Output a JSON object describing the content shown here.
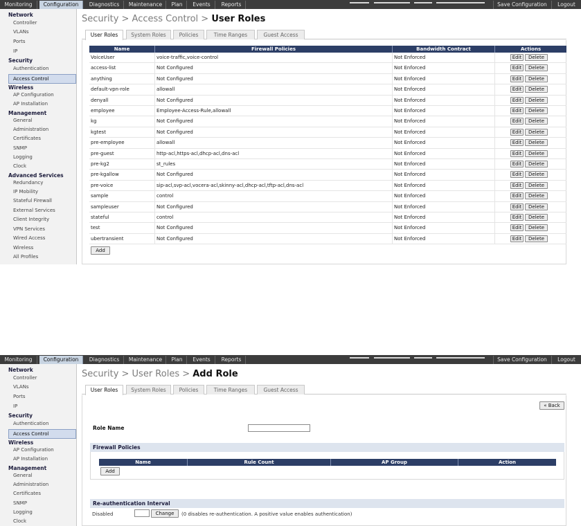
{
  "nav": {
    "tabs": [
      "Monitoring",
      "Configuration",
      "Diagnostics",
      "Maintenance",
      "Plan",
      "Events",
      "Reports"
    ],
    "active": "Configuration",
    "save_configuration": "Save Configuration",
    "logout": "Logout"
  },
  "sidebar": {
    "items": [
      {
        "label": "Network",
        "kind": "head"
      },
      {
        "label": "Controller",
        "kind": "sub"
      },
      {
        "label": "VLANs",
        "kind": "sub"
      },
      {
        "label": "Ports",
        "kind": "sub"
      },
      {
        "label": "IP",
        "kind": "sub"
      },
      {
        "label": "Security",
        "kind": "head"
      },
      {
        "label": "Authentication",
        "kind": "sub"
      },
      {
        "label": "Access Control",
        "kind": "sub",
        "selected": true
      },
      {
        "label": "Wireless",
        "kind": "head"
      },
      {
        "label": "AP Configuration",
        "kind": "sub"
      },
      {
        "label": "AP Installation",
        "kind": "sub"
      },
      {
        "label": "Management",
        "kind": "head"
      },
      {
        "label": "General",
        "kind": "sub"
      },
      {
        "label": "Administration",
        "kind": "sub"
      },
      {
        "label": "Certificates",
        "kind": "sub"
      },
      {
        "label": "SNMP",
        "kind": "sub"
      },
      {
        "label": "Logging",
        "kind": "sub"
      },
      {
        "label": "Clock",
        "kind": "sub"
      },
      {
        "label": "Advanced Services",
        "kind": "head"
      },
      {
        "label": "Redundancy",
        "kind": "sub"
      },
      {
        "label": "IP Mobility",
        "kind": "sub"
      },
      {
        "label": "Stateful Firewall",
        "kind": "sub"
      },
      {
        "label": "External Services",
        "kind": "sub"
      },
      {
        "label": "Client Integrity",
        "kind": "sub"
      },
      {
        "label": "VPN Services",
        "kind": "sub"
      },
      {
        "label": "Wired Access",
        "kind": "sub"
      },
      {
        "label": "Wireless",
        "kind": "sub"
      },
      {
        "label": "All Profiles",
        "kind": "sub"
      }
    ]
  },
  "screen1": {
    "breadcrumb": {
      "path": "Security > Access Control > ",
      "current": "User Roles"
    },
    "subtabs": [
      "User Roles",
      "System Roles",
      "Policies",
      "Time Ranges",
      "Guest Access"
    ],
    "table": {
      "columns": [
        "Name",
        "Firewall Policies",
        "Bandwidth Contract",
        "Actions"
      ],
      "rows": [
        {
          "name": "VoiceUser",
          "policies": "voice-traffic,voice-control",
          "bandwidth": "Not Enforced"
        },
        {
          "name": "access-list",
          "policies": "Not Configured",
          "bandwidth": "Not Enforced"
        },
        {
          "name": "anything",
          "policies": "Not Configured",
          "bandwidth": "Not Enforced"
        },
        {
          "name": "default-vpn-role",
          "policies": "allowall",
          "bandwidth": "Not Enforced"
        },
        {
          "name": "denyall",
          "policies": "Not Configured",
          "bandwidth": "Not Enforced"
        },
        {
          "name": "employee",
          "policies": "Employee-Access-Rule,allowall",
          "bandwidth": "Not Enforced"
        },
        {
          "name": "kg",
          "policies": "Not Configured",
          "bandwidth": "Not Enforced"
        },
        {
          "name": "kgtest",
          "policies": "Not Configured",
          "bandwidth": "Not Enforced"
        },
        {
          "name": "pre-employee",
          "policies": "allowall",
          "bandwidth": "Not Enforced"
        },
        {
          "name": "pre-guest",
          "policies": "http-acl,https-acl,dhcp-acl,dns-acl",
          "bandwidth": "Not Enforced"
        },
        {
          "name": "pre-kg2",
          "policies": "st_rules",
          "bandwidth": "Not Enforced"
        },
        {
          "name": "pre-kgallow",
          "policies": "Not Configured",
          "bandwidth": "Not Enforced"
        },
        {
          "name": "pre-voice",
          "policies": "sip-acl,svp-acl,vocera-acl,skinny-acl,dhcp-acl,tftp-acl,dns-acl",
          "bandwidth": "Not Enforced"
        },
        {
          "name": "sample",
          "policies": "control",
          "bandwidth": "Not Enforced"
        },
        {
          "name": "sampleuser",
          "policies": "Not Configured",
          "bandwidth": "Not Enforced"
        },
        {
          "name": "stateful",
          "policies": "control",
          "bandwidth": "Not Enforced"
        },
        {
          "name": "test",
          "policies": "Not Configured",
          "bandwidth": "Not Enforced"
        },
        {
          "name": "ubertransient",
          "policies": "Not Configured",
          "bandwidth": "Not Enforced"
        }
      ],
      "edit_label": "Edit",
      "delete_label": "Delete"
    },
    "add_label": "Add"
  },
  "screen2": {
    "breadcrumb": {
      "path": "Security > User Roles > ",
      "current": "Add Role"
    },
    "subtabs": [
      "User Roles",
      "System Roles",
      "Policies",
      "Time Ranges",
      "Guest Access"
    ],
    "back_label": "« Back",
    "role_name_label": "Role Name",
    "role_name_value": "",
    "firewall_policies_title": "Firewall Policies",
    "fp_columns": [
      "Name",
      "Rule Count",
      "AP Group",
      "Action"
    ],
    "fp_add_label": "Add",
    "reauth_title": "Re-authentication Interval",
    "reauth_label": "Disabled",
    "reauth_value": "",
    "change_label": "Change",
    "reauth_hint": "(0 disables re-authentication. A positive value enables authentication)"
  }
}
